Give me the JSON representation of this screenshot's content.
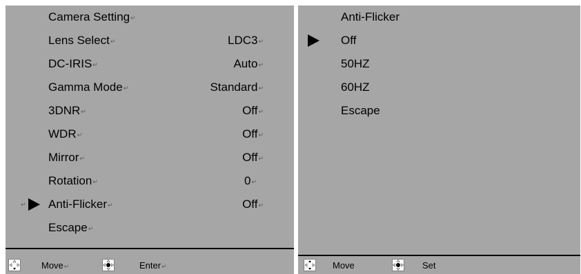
{
  "left_menu": {
    "title": "Camera Setting",
    "items": [
      {
        "label": "Lens Select",
        "value": "LDC3"
      },
      {
        "label": "DC-IRIS",
        "value": "Auto"
      },
      {
        "label": "Gamma Mode",
        "value": "Standard"
      },
      {
        "label": "3DNR",
        "value": "Off"
      },
      {
        "label": "WDR",
        "value": "Off"
      },
      {
        "label": "Mirror",
        "value": "Off"
      },
      {
        "label": "Rotation",
        "value": "0"
      },
      {
        "label": "Anti-Flicker",
        "value": "Off"
      }
    ],
    "escape": "Escape",
    "selected_item": "Anti-Flicker",
    "footer": {
      "move": "Move",
      "enter": "Enter"
    }
  },
  "right_menu": {
    "title": "Anti-Flicker",
    "options": [
      "Off",
      "50HZ",
      "60HZ"
    ],
    "escape": "Escape",
    "selected_option": "Off",
    "footer": {
      "move": "Move",
      "set": "Set"
    }
  },
  "paragraph_mark": "↵",
  "colors": {
    "panel_bg": "#a6a6a6",
    "text": "#000000",
    "separator": "#000000"
  },
  "icons": {
    "move_icon": "four-way-arrows-icon",
    "enter_icon": "four-way-arrows-center-dot-icon",
    "selector_icon": "triangle-right-icon"
  }
}
